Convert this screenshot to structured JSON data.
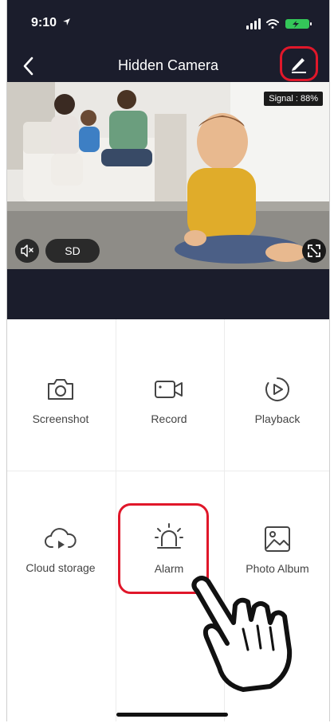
{
  "status_bar": {
    "time": "9:10"
  },
  "header": {
    "title": "Hidden Camera"
  },
  "video": {
    "signal": "Signal : 88%",
    "quality_label": "SD"
  },
  "features": [
    {
      "label": "Screenshot",
      "icon": "camera-icon"
    },
    {
      "label": "Record",
      "icon": "video-camera-icon"
    },
    {
      "label": "Playback",
      "icon": "playback-icon"
    },
    {
      "label": "Cloud storage",
      "icon": "cloud-play-icon"
    },
    {
      "label": "Alarm",
      "icon": "alarm-siren-icon"
    },
    {
      "label": "Photo Album",
      "icon": "image-icon"
    }
  ],
  "highlights": [
    "edit-button",
    "alarm-button"
  ],
  "colors": {
    "header_bg": "#1b1d2c",
    "highlight": "#e0172a",
    "icon": "#444444"
  }
}
